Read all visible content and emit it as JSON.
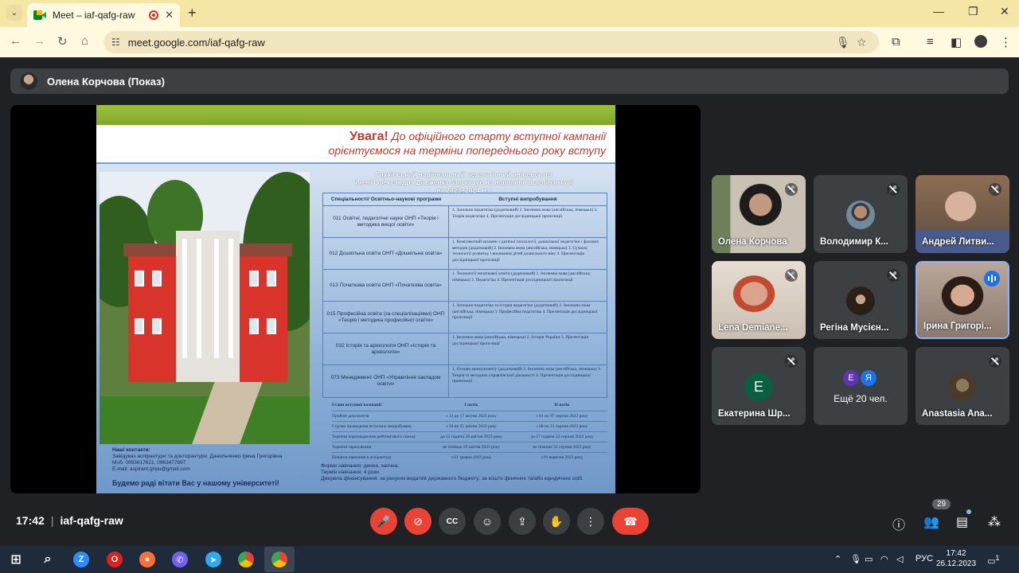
{
  "browser": {
    "tab_title": "Meet – iaf-qafg-raw",
    "url": "meet.google.com/iaf-qafg-raw"
  },
  "meeting": {
    "presenter_label": "Олена Корчова (Показ)",
    "time": "17:42",
    "code": "iaf-qafg-raw",
    "participant_count": "29"
  },
  "slide": {
    "warning_word": "Увага!",
    "warning_line1": " До офіційного старту вступної кампанії",
    "warning_line2": "орієнтуємося на терміни попереднього року вступу",
    "university_title": [
      "Глухівський національний педагогічний університет",
      "імені Олександра Довженка запрошує на навчання в аспірантурі",
      "на 2023–2024 н.р"
    ],
    "table_header": {
      "programs": "Спеціальності/ Освітньо-наукові програми",
      "exams": "Вступні випробування"
    },
    "programs": [
      {
        "name": "011 Освітні, педагогічні науки ОНП «Теорія і методика вищої освіти»",
        "exams": "1. Загальна педагогіка (додатковий) 2. Іноземна мова (англійська, німецька) 3. Теорія педагогіки 4. Презентація дослідницької пропозиції"
      },
      {
        "name": "012 Дошкільна освіта ОНП «Дошкільна освіта»",
        "exams": "1. Комплексний екзамен з дитячої психології, дошкільної педагогіки і фахових методик (додатковий) 2. Іноземна мова (англійська, німецька) 3. Сучасні технології розвитку і виховання дітей дошкільного віку 4. Презентація дослідницької пропозиції"
      },
      {
        "name": "013 Початкова освіта ОНП «Початкова освіта»",
        "exams": "1. Технології початкової освіти (додатковий) 2. Іноземна мова (англійська, німецька) 3. Педагогіка 4. Презентація дослідницької пропозиції"
      },
      {
        "name": "015 Професійна освіта (за спеціалізаціями) ОНП «Теорія і методика професійної освіти»",
        "exams": "1. Загальна педагогіка та історія педагогіки (додатковий) 2. Іноземна мова (англійська, німецька) 3. Професійна педагогіка 4. Презентація дослідницької пропозиції"
      },
      {
        "name": "032 Історія та археологія ОНП «Історія та археологія»",
        "exams": "1. Іноземна мова (англійська, німецька) 2. Історія України 3. Презентація дослідницької пропозиції"
      },
      {
        "name": "073 Менеджмент ОНП «Управління закладом освіти»",
        "exams": "1. Основи менеджменту (додатковий) 2. Іноземна мова (англійська, німецька) 3. Теорія та методика управлінської діяльності 4. Презентація дослідницької пропозиції"
      }
    ],
    "stages_header": {
      "stage": "Етапи вступної кампанії:",
      "flow1": "І потік",
      "flow2": "ІІ потік"
    },
    "stages": [
      {
        "stage": "Прийом документів",
        "flow1": "з 13 до 17 квітня 2023 року",
        "flow2": "з 01 по 07 серпня 2023 року"
      },
      {
        "stage": "Строки проведення вступних випробувань",
        "flow1": "з 18 по 25 квітня 2023 року",
        "flow2": "з 08 по 21 серпня 2023 року"
      },
      {
        "stage": "Терміни оприлюднення рейтингового списку",
        "flow1": "до 12 години 26 квітня 2023 року",
        "flow2": "до 17 години 22 серпня 2023 року"
      },
      {
        "stage": "Терміни зарахування",
        "flow1": "не пізніше 29 квітня 2023 року",
        "flow2": "не пізніше 31 серпня 2023 року"
      },
      {
        "stage": "Початок навчання в аспірантурі",
        "flow1": "з 01 травня 2023 року",
        "flow2": "з 01 вересня 2023 року"
      }
    ],
    "contacts_title": "Наші контакти:",
    "contacts_line1": "Завідувач аспірантури та докторантури: Данильченко Ірина Григорівна",
    "contacts_line2": "Моб. 0993617621, 0963477897",
    "contacts_line3": "E-mail: aspirant.gnpu@gmail.com",
    "forms_line1": "Форми навчання: денна, заочна.",
    "forms_line2": "Термін навчання: 4 роки.",
    "forms_line3": "Джерела фінансування: за рахунок видатків державного бюджету; за кошти фізичних та/або юридичних осіб.",
    "welcome": "Будемо раді вітати Вас у нашому університеті!"
  },
  "participants": [
    {
      "name": "Олена Корчова"
    },
    {
      "name": "Володимир К..."
    },
    {
      "name": "Андрей Литви..."
    },
    {
      "name": "Lena Demiane..."
    },
    {
      "name": "Регіна Мусієн..."
    },
    {
      "name": "Ірина Григорі..."
    },
    {
      "name": "Екатерина Шр...",
      "initial": "Е"
    },
    {
      "name": "Ещё 20 чел.",
      "initials": [
        "Е",
        "Я"
      ]
    },
    {
      "name": "Anastasia Ana..."
    }
  ],
  "taskbar": {
    "lang": "РУС",
    "time": "17:42",
    "date": "26.12.2023",
    "notif_count": "1"
  }
}
